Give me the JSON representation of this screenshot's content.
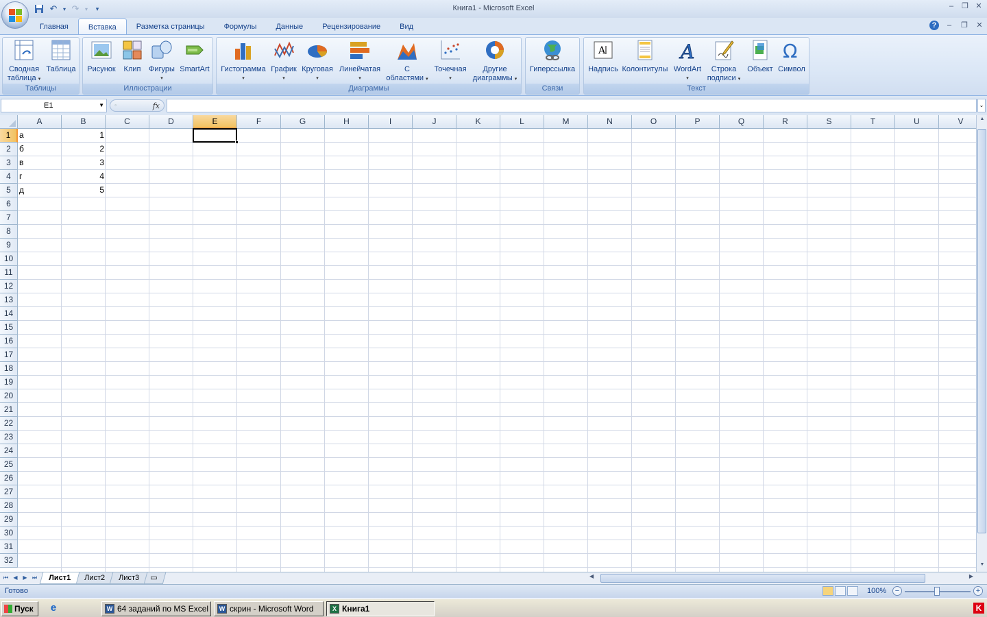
{
  "window": {
    "title": "Книга1 - Microsoft Excel"
  },
  "qat": {
    "save": "save-icon",
    "undo": "undo-icon",
    "redo": "redo-icon",
    "customize": "▾"
  },
  "tabs": [
    {
      "label": "Главная"
    },
    {
      "label": "Вставка",
      "active": true
    },
    {
      "label": "Разметка страницы"
    },
    {
      "label": "Формулы"
    },
    {
      "label": "Данные"
    },
    {
      "label": "Рецензирование"
    },
    {
      "label": "Вид"
    }
  ],
  "ribbon": {
    "groups": {
      "tables": "Таблицы",
      "illustrations": "Иллюстрации",
      "charts": "Диаграммы",
      "links": "Связи",
      "text": "Текст"
    },
    "buttons": {
      "pivot_l1": "Сводная",
      "pivot_l2": "таблица",
      "table": "Таблица",
      "picture": "Рисунок",
      "clip": "Клип",
      "shapes": "Фигуры",
      "smartart": "SmartArt",
      "column": "Гистограмма",
      "line": "График",
      "pie": "Круговая",
      "bar": "Линейчатая",
      "area_l1": "С",
      "area_l2": "областями",
      "scatter": "Точечная",
      "other_l1": "Другие",
      "other_l2": "диаграммы",
      "hyperlink": "Гиперссылка",
      "textbox": "Надпись",
      "headerfooter": "Колонтитулы",
      "wordart": "WordArt",
      "sigline_l1": "Строка",
      "sigline_l2": "подписи",
      "object": "Объект",
      "symbol": "Символ"
    }
  },
  "formula_bar": {
    "name_box": "E1",
    "fx": "fx",
    "value": ""
  },
  "columns": [
    "A",
    "B",
    "C",
    "D",
    "E",
    "F",
    "G",
    "H",
    "I",
    "J",
    "K",
    "L",
    "M",
    "N",
    "O",
    "P",
    "Q",
    "R",
    "S",
    "T",
    "U",
    "V"
  ],
  "rows": [
    "1",
    "2",
    "3",
    "4",
    "5",
    "6",
    "7",
    "8",
    "9",
    "10",
    "11",
    "12",
    "13",
    "14",
    "15",
    "16",
    "17",
    "18",
    "19",
    "20",
    "21",
    "22",
    "23",
    "24",
    "25",
    "26",
    "27",
    "28",
    "29",
    "30",
    "31",
    "32"
  ],
  "cells": {
    "A1": "а",
    "B1": "1",
    "A2": "б",
    "B2": "2",
    "A3": "в",
    "B3": "3",
    "A4": "г",
    "B4": "4",
    "A5": "д",
    "B5": "5"
  },
  "active_cell": "E1",
  "sheets": [
    {
      "label": "Лист1",
      "active": true
    },
    {
      "label": "Лист2"
    },
    {
      "label": "Лист3"
    }
  ],
  "status": {
    "text": "Готово",
    "zoom": "100%"
  },
  "taskbar": {
    "start": "Пуск",
    "items": [
      {
        "label": "64 заданий по MS Excel ...",
        "icon": "W"
      },
      {
        "label": "скрин - Microsoft Word",
        "icon": "W"
      },
      {
        "label": "Книга1",
        "icon": "X",
        "active": true
      }
    ],
    "tray": "K"
  },
  "colors": {
    "accent": "#15428b",
    "selection": "#f1c15f",
    "ribbon": "#dbe7f6"
  }
}
